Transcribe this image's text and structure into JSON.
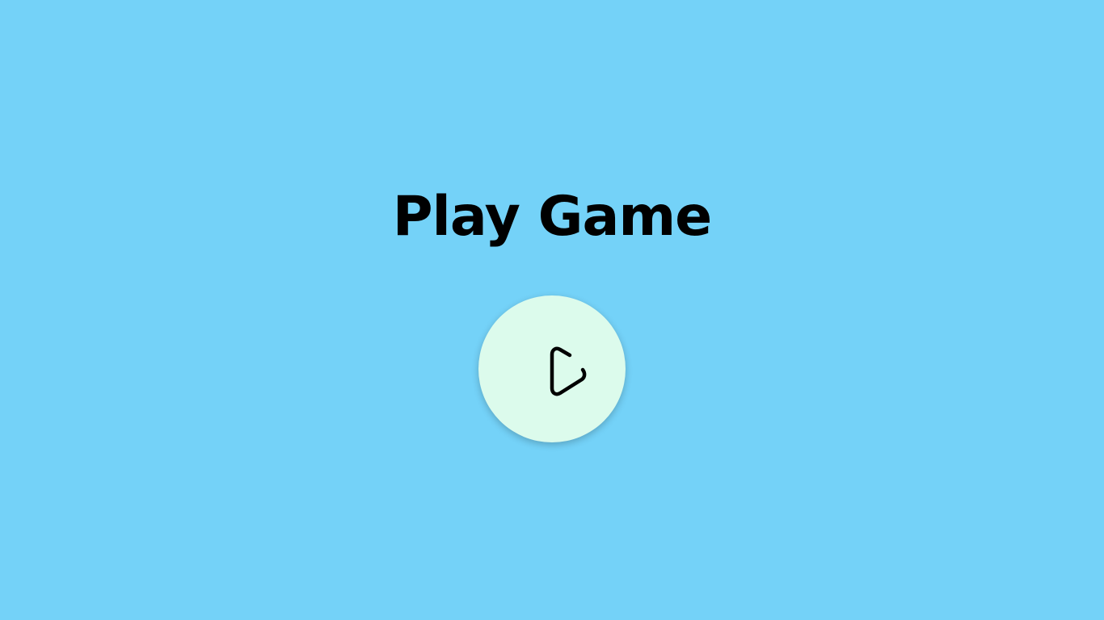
{
  "page": {
    "title": "Play Game",
    "background_color": "#74d2f8"
  },
  "play_button": {
    "icon": "play-icon",
    "background_color": "#dcfbec"
  }
}
